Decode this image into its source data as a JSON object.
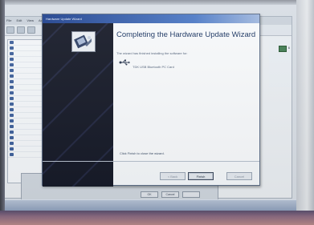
{
  "background_window": {
    "menu": [
      "File",
      "Edit",
      "View",
      "Action"
    ],
    "tree_items": [
      "",
      "",
      "",
      "",
      "",
      "",
      "",
      "",
      "",
      "",
      "",
      "",
      "",
      "",
      "",
      "",
      "",
      "",
      "",
      "",
      ""
    ],
    "right_label": "6"
  },
  "background_dialog": {
    "ok_label": "OK",
    "cancel_label": "Cancel",
    "help_label": ""
  },
  "wizard": {
    "title": "Hardware Update Wizard",
    "heading": "Completing the Hardware Update Wizard",
    "description": "The wizard has finished installing the software for:",
    "device_name": "TDK USB Bluetooth PC Card",
    "finish_instruction": "Click Finish to close the wizard.",
    "back_label": "< Back",
    "finish_label": "Finish",
    "cancel_label": "Cancel",
    "colors": {
      "titlebar": "#1d3f8c",
      "side_panel": "#141826",
      "heading": "#15305e"
    },
    "icons": {
      "logo": "hardware-wizard-icon",
      "device": "usb-icon"
    }
  }
}
